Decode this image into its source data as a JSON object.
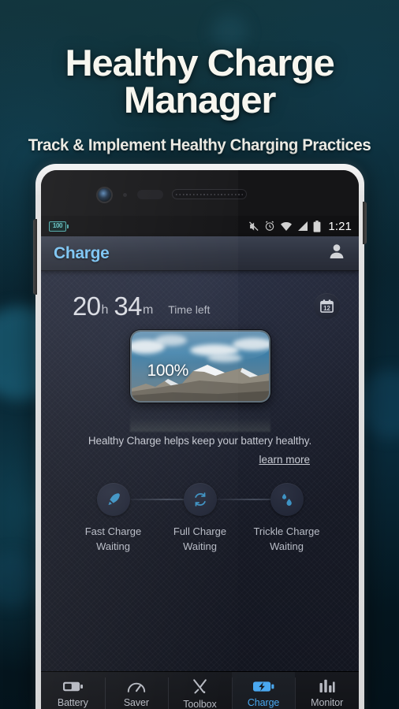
{
  "promo": {
    "title": "Healthy Charge Manager",
    "subtitle": "Track & Implement Healthy Charging Practices"
  },
  "statusbar": {
    "battery_level": "100",
    "time": "1:21",
    "icons": [
      "mute-icon",
      "alarm-icon",
      "wifi-icon",
      "signal-icon",
      "battery-icon"
    ]
  },
  "appbar": {
    "title": "Charge",
    "action_icon": "account-icon"
  },
  "timeleft": {
    "hours": "20",
    "hours_unit": "h",
    "minutes": "34",
    "minutes_unit": "m",
    "label": "Time left",
    "calendar_day": "12"
  },
  "battery": {
    "percent": "100%"
  },
  "description": {
    "text": "Healthy Charge helps keep your battery healthy.",
    "link": "learn more"
  },
  "stages": [
    {
      "icon": "rocket-icon",
      "name": "Fast Charge",
      "status": "Waiting"
    },
    {
      "icon": "refresh-icon",
      "name": "Full Charge",
      "status": "Waiting"
    },
    {
      "icon": "droplet-icon",
      "name": "Trickle Charge",
      "status": "Waiting"
    }
  ],
  "nav": [
    {
      "label": "Battery",
      "icon": "battery-icon",
      "active": false
    },
    {
      "label": "Saver",
      "icon": "gauge-icon",
      "active": false
    },
    {
      "label": "Toolbox",
      "icon": "tools-icon",
      "active": false
    },
    {
      "label": "Charge",
      "icon": "charge-icon",
      "active": true
    },
    {
      "label": "Monitor",
      "icon": "barchart-icon",
      "active": false
    }
  ],
  "colors": {
    "accent": "#4aa8f0",
    "title_accent": "#79c3f2",
    "status_battery": "#4ea8a8",
    "stage_icon": "#3e93c4"
  }
}
